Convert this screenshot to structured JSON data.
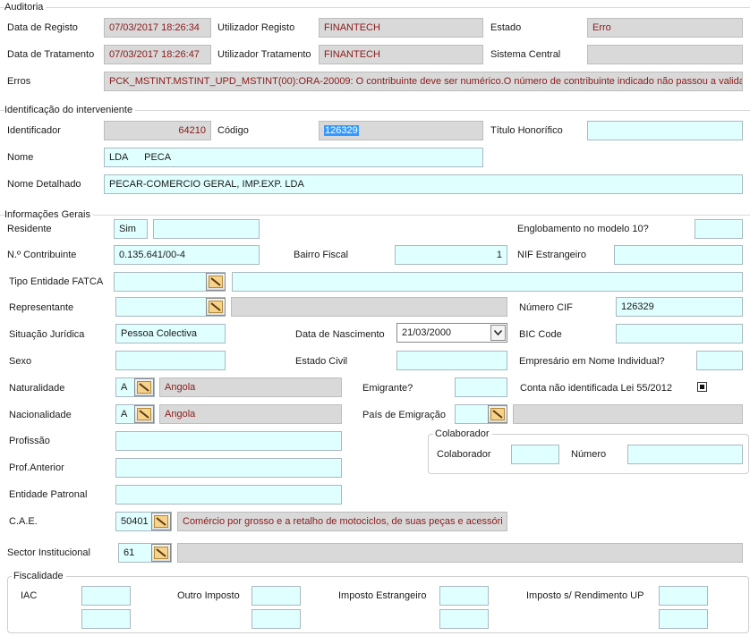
{
  "auditoria": {
    "title": "Auditoria",
    "data_registo_label": "Data de Registo",
    "data_registo_value": "07/03/2017 18:26:34",
    "utilizador_registo_label": "Utilizador Registo",
    "utilizador_registo_value": "FINANTECH",
    "estado_label": "Estado",
    "estado_value": "Erro",
    "data_tratamento_label": "Data de Tratamento",
    "data_tratamento_value": "07/03/2017 18:26:47",
    "utilizador_tratamento_label": "Utilizador Tratamento",
    "utilizador_tratamento_value": "FINANTECH",
    "sistema_central_label": "Sistema Central",
    "sistema_central_value": "",
    "erros_label": "Erros",
    "erros_value": "PCK_MSTINT.MSTINT_UPD_MSTINT(00):ORA-20009: O contribuinte deve ser numérico.O número de contribuinte indicado não passou a validaç"
  },
  "identificacao": {
    "title": "Identificação do interveniente",
    "identificador_label": "Identificador",
    "identificador_value": "64210",
    "codigo_label": "Código",
    "codigo_value": "126329",
    "titulo_label": "Título Honorífico",
    "titulo_value": "",
    "nome_label": "Nome",
    "nome_value": "LDA      PECA",
    "nome_detalhado_label": "Nome Detalhado",
    "nome_detalhado_value": "PECAR-COMERCIO GERAL, IMP.EXP. LDA"
  },
  "informacoes": {
    "title": "Informações Gerais",
    "residente_label": "Residente",
    "residente_value": "Sim",
    "englobamento_label": "Englobamento no modelo 10?",
    "contribuinte_label": "N.º Contribuinte",
    "contribuinte_value": "0.135.641/00-4",
    "bairro_label": "Bairro Fiscal",
    "bairro_value": "1",
    "nif_estrangeiro_label": "NIF Estrangeiro",
    "tipo_entidade_label": "Tipo Entidade FATCA",
    "representante_label": "Representante",
    "numero_cif_label": "Número CIF",
    "numero_cif_value": "126329",
    "situacao_label": "Situação Jurídica",
    "situacao_value": "Pessoa Colectiva",
    "data_nascimento_label": "Data de Nascimento",
    "data_nascimento_value": "21/03/2000",
    "bic_label": "BIC Code",
    "sexo_label": "Sexo",
    "estado_civil_label": "Estado Civil",
    "empresario_label": "Empresário em Nome Individual?",
    "naturalidade_label": "Naturalidade",
    "naturalidade_code": "A",
    "naturalidade_value": "Angola",
    "emigrante_label": "Emigrante?",
    "conta_label": "Conta não identificada Lei 55/2012",
    "nacionalidade_label": "Nacionalidade",
    "nacionalidade_code": "A",
    "nacionalidade_value": "Angola",
    "pais_emigracao_label": "País de Emigração",
    "profissao_label": "Profissão",
    "prof_anterior_label": "Prof.Anterior",
    "entidade_patronal_label": "Entidade Patronal",
    "cae_label": "C.A.E.",
    "cae_code": "50401",
    "cae_value": "Comércio por grosso e a retalho de motociclos, de suas peças e acessóri",
    "sector_label": "Sector Institucional",
    "sector_code": "61"
  },
  "colaborador": {
    "title": "Colaborador",
    "colaborador_label": "Colaborador",
    "numero_label": "Número"
  },
  "fiscalidade": {
    "title": "Fiscalidade",
    "iac_label": "IAC",
    "outro_label": "Outro Imposto",
    "estrangeiro_label": "Imposto Estrangeiro",
    "rendimento_label": "Imposto s/ Rendimento UP"
  }
}
